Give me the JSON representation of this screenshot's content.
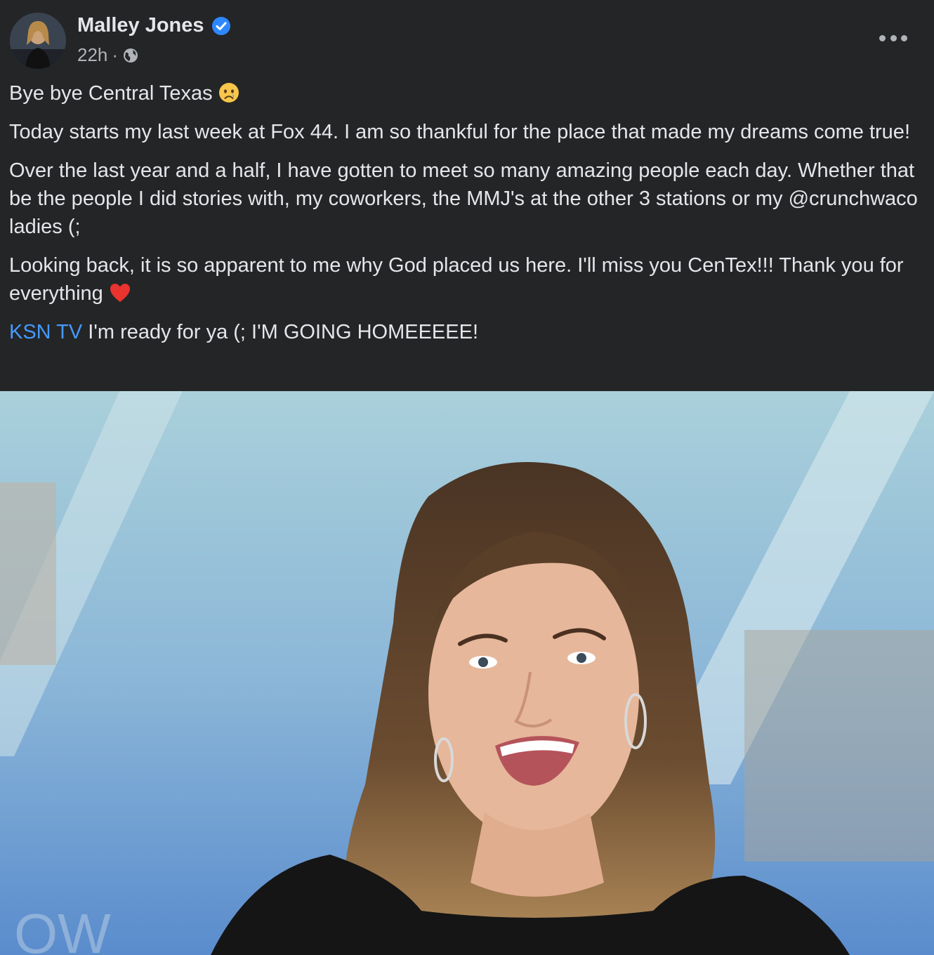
{
  "post": {
    "author": "Malley Jones",
    "verified": true,
    "timestamp": "22h",
    "separator": "·",
    "privacy_icon": "globe-icon",
    "more_icon": "more-options-icon"
  },
  "content": {
    "line1": "Bye bye Central Texas",
    "line1_emoji": "crying-face",
    "para2": "Today starts my last week at Fox 44. I am so thankful for the place that made my dreams come true!",
    "para3": "Over the last year and a half, I have gotten to meet so many amazing people each day. Whether that be the people I did stories with, my coworkers, the MMJ's at the other 3 stations or my @crunchwaco ladies (;",
    "para4": "Looking back, it is so apparent to me why God placed us here. I'll miss you CenTex!!! Thank you for everything",
    "para4_emoji": "red-heart",
    "tag": "KSN TV",
    "para5_rest": " I'm ready for ya (; I'M GOING HOMEEEEE!"
  },
  "photo": {
    "description_icon": "news-anchor-photo"
  },
  "colors": {
    "background": "#242526",
    "text": "#e4e6eb",
    "secondary": "#b0b3b8",
    "link": "#4599ff",
    "verified": "#2d88ff"
  }
}
